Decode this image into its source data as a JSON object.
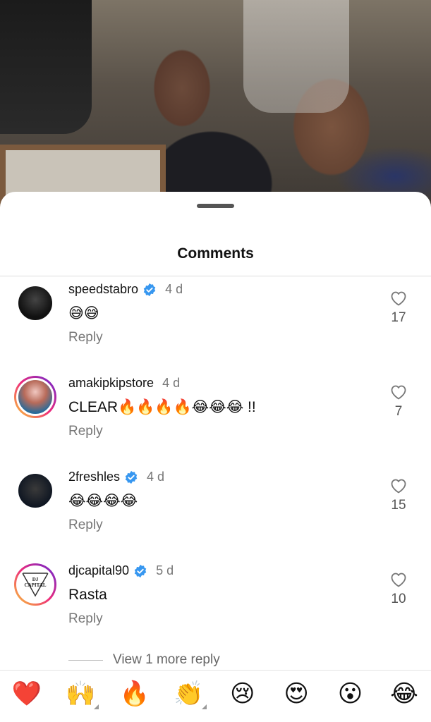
{
  "sheet": {
    "title": "Comments"
  },
  "comments": [
    {
      "user": "speedstabro",
      "verified": true,
      "time": "4 d",
      "text": "😅😅",
      "reply_label": "Reply",
      "likes": "17",
      "avatar_style": "dark",
      "story_ring": false
    },
    {
      "user": "amakipkipstore",
      "verified": false,
      "time": "4 d",
      "text": "CLEAR🔥🔥🔥🔥😂😂😂 !!",
      "reply_label": "Reply",
      "likes": "7",
      "avatar_style": "pink",
      "story_ring": true
    },
    {
      "user": "2freshles",
      "verified": true,
      "time": "4 d",
      "text": "😂😂😂😂",
      "reply_label": "Reply",
      "likes": "15",
      "avatar_style": "night",
      "story_ring": false
    },
    {
      "user": "djcapital90",
      "verified": true,
      "time": "5 d",
      "text": "Rasta",
      "reply_label": "Reply",
      "likes": "10",
      "avatar_style": "logo",
      "avatar_logo_text": "DJ CAPITAL",
      "story_ring": true
    }
  ],
  "view_more_replies": "View 1 more reply",
  "quick_reactions": [
    {
      "emoji": "❤️",
      "name": "red-heart",
      "has_skin_tone": false
    },
    {
      "emoji": "🙌",
      "name": "raising-hands",
      "has_skin_tone": true
    },
    {
      "emoji": "🔥",
      "name": "fire",
      "has_skin_tone": false
    },
    {
      "emoji": "👏",
      "name": "clapping-hands",
      "has_skin_tone": true
    },
    {
      "emoji": "😢",
      "name": "crying-face",
      "has_skin_tone": false
    },
    {
      "emoji": "😍",
      "name": "heart-eyes",
      "has_skin_tone": false
    },
    {
      "emoji": "😮",
      "name": "open-mouth-face",
      "has_skin_tone": false
    },
    {
      "emoji": "😂",
      "name": "tears-of-joy",
      "has_skin_tone": false
    }
  ],
  "colors": {
    "verified_badge": "#3797f0",
    "story_ring_start": "#f9ce34",
    "story_ring_end": "#6228d7",
    "secondary_text": "#777777"
  }
}
